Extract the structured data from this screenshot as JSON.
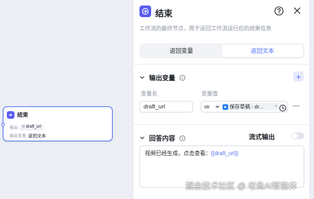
{
  "canvas": {
    "node": {
      "title": "结束",
      "output_label": "输出",
      "output_var": "draft_url",
      "answer_label": "输出变量",
      "answer_value": "返回文本"
    }
  },
  "panel": {
    "title": "结束",
    "description": "工作流的最终节点，用于返回工作流运行后的结果信息",
    "tabs": [
      {
        "label": "返回变量",
        "active": false
      },
      {
        "label": "返回文本",
        "active": true
      }
    ],
    "output_section": {
      "title": "输出变量",
      "col_name": "变量名",
      "col_value": "变量值",
      "rows": [
        {
          "name": "draft_url",
          "type": "str",
          "ref": "保存草稿 - dr..."
        }
      ]
    },
    "answer_section": {
      "title": "回答内容",
      "stream_label": "流式输出",
      "stream_enabled": false,
      "text_prefix": "视频已经生成，点击查看：",
      "text_var": "{{draft_url}}"
    }
  },
  "watermark": "掘金技术社区 @ 老鱼AI智能体",
  "colors": {
    "accent": "#4e6ef2",
    "node_icon": "#5b5ef0",
    "ref_app": "#1d7af3"
  }
}
